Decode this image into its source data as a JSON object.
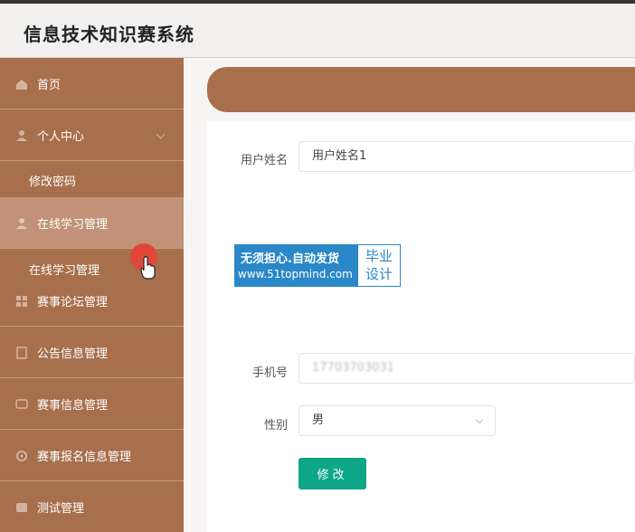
{
  "app": {
    "title": "信息技术知识赛系统"
  },
  "sidebar": {
    "items": [
      {
        "label": "首页",
        "icon": "home-icon"
      },
      {
        "label": "个人中心",
        "icon": "user-icon"
      },
      {
        "label": "修改密码"
      },
      {
        "label": "在线学习管理",
        "icon": "user-icon"
      },
      {
        "label": "在线学习管理"
      },
      {
        "label": "赛事论坛管理",
        "icon": "grid-icon"
      },
      {
        "label": "公告信息管理",
        "icon": "doc-icon"
      },
      {
        "label": "赛事信息管理",
        "icon": "chat-icon"
      },
      {
        "label": "赛事报名信息管理",
        "icon": "gear-icon"
      },
      {
        "label": "测试管理",
        "icon": "list-icon"
      }
    ]
  },
  "form": {
    "name_label": "用户姓名",
    "name_value": "用户姓名1",
    "phone_label": "手机号",
    "phone_value": "17703703031",
    "gender_label": "性别",
    "gender_value": "男",
    "submit_label": "修改"
  },
  "watermark": {
    "line1": "无须担心.自动发货",
    "line2": "www.51topmind.com",
    "right_line1": "毕业",
    "right_line2": "设计"
  },
  "colors": {
    "sidebar": "#a86f4c",
    "accent": "#0da688",
    "watermark": "#2a87c8"
  }
}
